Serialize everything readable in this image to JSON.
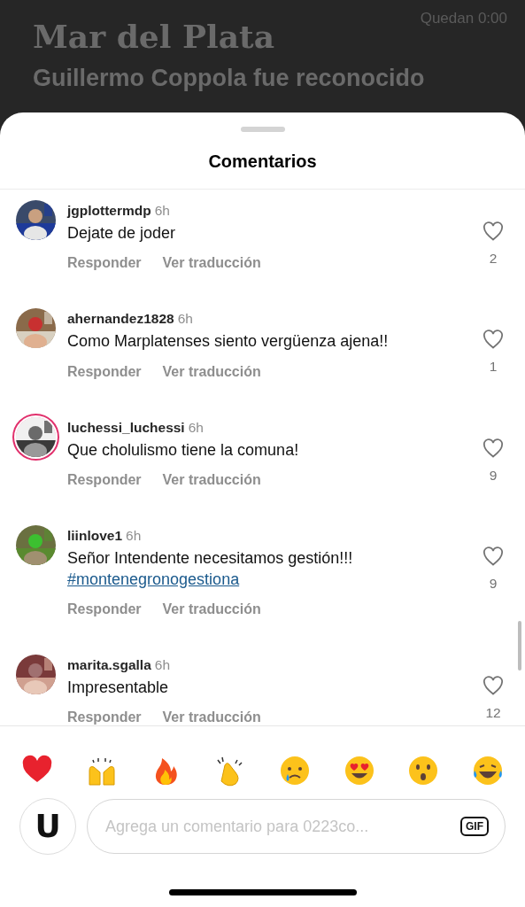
{
  "background_article": {
    "timer": "Quedan 0:00",
    "section": "Mar del Plata",
    "headline": "Guillermo Coppola fue reconocido"
  },
  "sheet": {
    "title": "Comentarios"
  },
  "comments": [
    {
      "username": "jgplottermdp",
      "time": "6h",
      "text": "Dejate de joder",
      "reply": "Responder",
      "translate": "Ver traducción",
      "likes": "2",
      "liked": false,
      "story_ring": false
    },
    {
      "username": "ahernandez1828",
      "time": "6h",
      "text": "Como Marplatenses siento vergüenza ajena!!",
      "reply": "Responder",
      "translate": "Ver traducción",
      "likes": "1",
      "liked": false,
      "story_ring": false
    },
    {
      "username": "luchessi_luchessi",
      "time": "6h",
      "text": "Que cholulismo tiene la comuna!",
      "reply": "Responder",
      "translate": "Ver traducción",
      "likes": "9",
      "liked": false,
      "story_ring": true
    },
    {
      "username": "liinlove1",
      "time": "6h",
      "text": "Señor Intendente necesitamos gestión!!!",
      "hashtag": "#montenegronogestiona",
      "reply": "Responder",
      "translate": "Ver traducción",
      "likes": "9",
      "liked": false,
      "story_ring": false
    },
    {
      "username": "marita.sgalla",
      "time": "6h",
      "text": "Impresentable",
      "reply": "Responder",
      "translate": "Ver traducción",
      "likes": "12",
      "liked": false,
      "story_ring": false
    }
  ],
  "composer": {
    "avatar_letter": "U",
    "placeholder": "Agrega un comentario para 0223co...",
    "gif_button": "GIF"
  }
}
